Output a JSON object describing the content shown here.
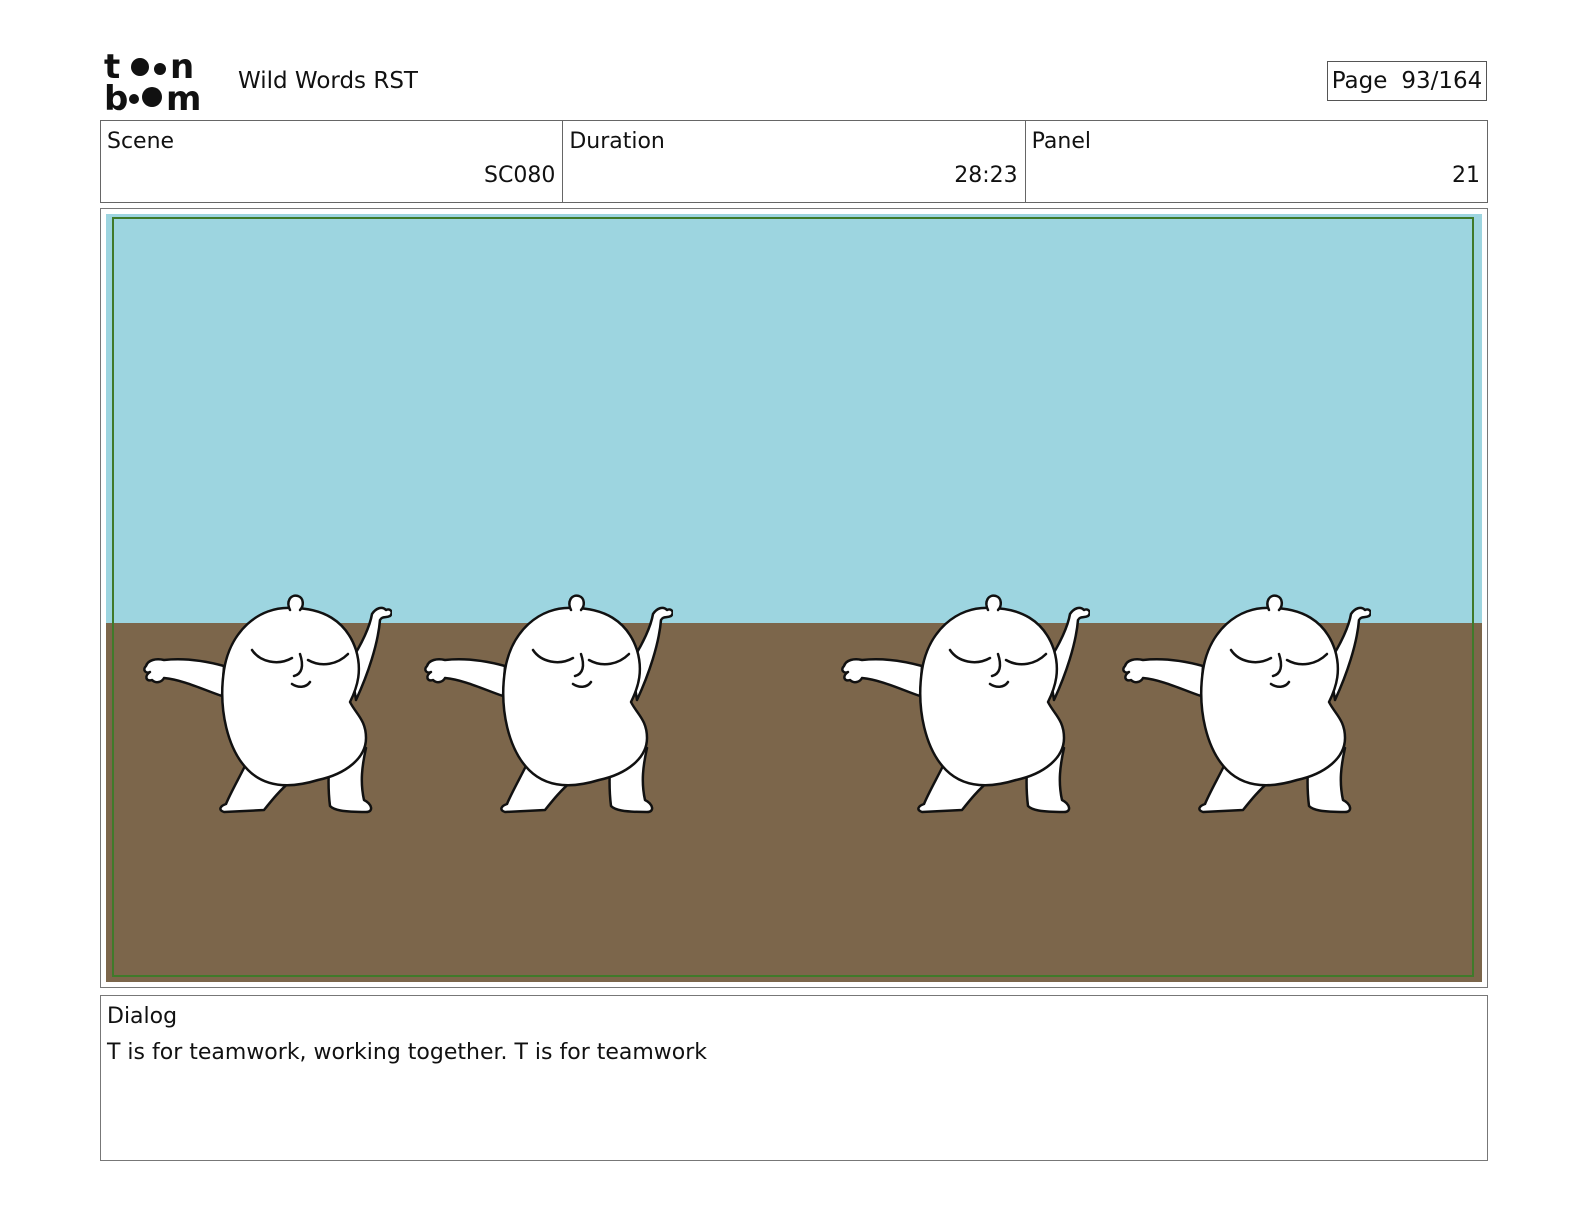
{
  "header": {
    "logo_lines": [
      "toon",
      "boom"
    ],
    "project_title": "Wild Words RST",
    "page_label": "Page",
    "page_value": "93/164"
  },
  "info": {
    "scene_label": "Scene",
    "scene_value": "SC080",
    "duration_label": "Duration",
    "duration_value": "28:23",
    "panel_label": "Panel",
    "panel_value": "21"
  },
  "artwork": {
    "sky_color": "#9dd5e0",
    "ground_color": "#7c664b",
    "safe_frame_color": "#3f7a2a",
    "figures": 4
  },
  "dialog": {
    "label": "Dialog",
    "text": "T is for teamwork, working together. T is for teamwork"
  }
}
